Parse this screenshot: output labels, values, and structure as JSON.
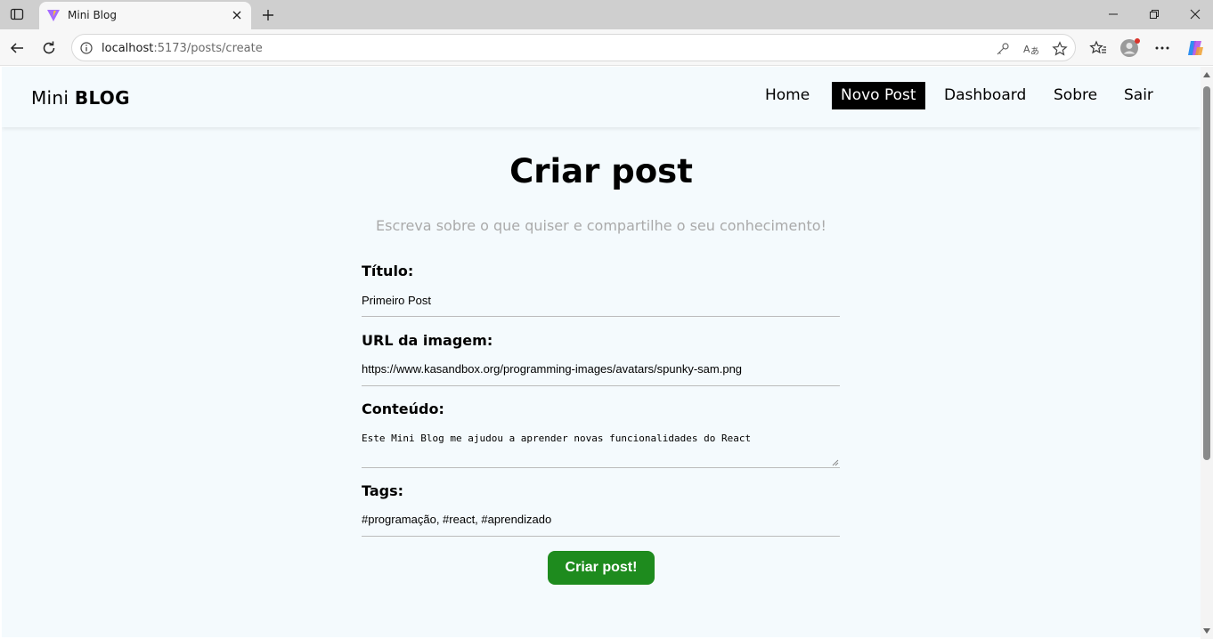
{
  "browser": {
    "tab_title": "Mini Blog",
    "url_host": "localhost",
    "url_path": ":5173/posts/create"
  },
  "icons": {
    "sidebar": "sidebar-icon",
    "favicon": "vite-logo-icon",
    "close": "close-icon",
    "new_tab": "plus-icon",
    "back": "back-arrow-icon",
    "reload": "reload-icon",
    "info": "info-icon",
    "password": "key-icon",
    "translate": "translate-icon",
    "favorite": "star-icon",
    "favorites": "favorites-icon",
    "profile": "profile-icon",
    "more": "more-icon",
    "copilot": "copilot-icon"
  },
  "navbar": {
    "brand_light": "Mini",
    "brand_bold": "BLOG",
    "links": [
      "Home",
      "Novo Post",
      "Dashboard",
      "Sobre",
      "Sair"
    ],
    "active": "Novo Post"
  },
  "main": {
    "title": "Criar post",
    "subtitle": "Escreva sobre o que quiser e compartilhe o seu conhecimento!",
    "fields": [
      {
        "label": "Título:",
        "value": "Primeiro Post"
      },
      {
        "label": "URL da imagem:",
        "value": "https://www.kasandbox.org/programming-images/avatars/spunky-sam.png"
      },
      {
        "label": "Conteúdo:",
        "value": "Este Mini Blog me ajudou a aprender novas funcionalidades do React"
      },
      {
        "label": "Tags:",
        "value": "#programação, #react, #aprendizado"
      }
    ],
    "submit_label": "Criar post!"
  },
  "colors": {
    "page_bg": "#f4fafd",
    "active_nav_bg": "#000000",
    "submit_bg": "#1e8b1e"
  }
}
